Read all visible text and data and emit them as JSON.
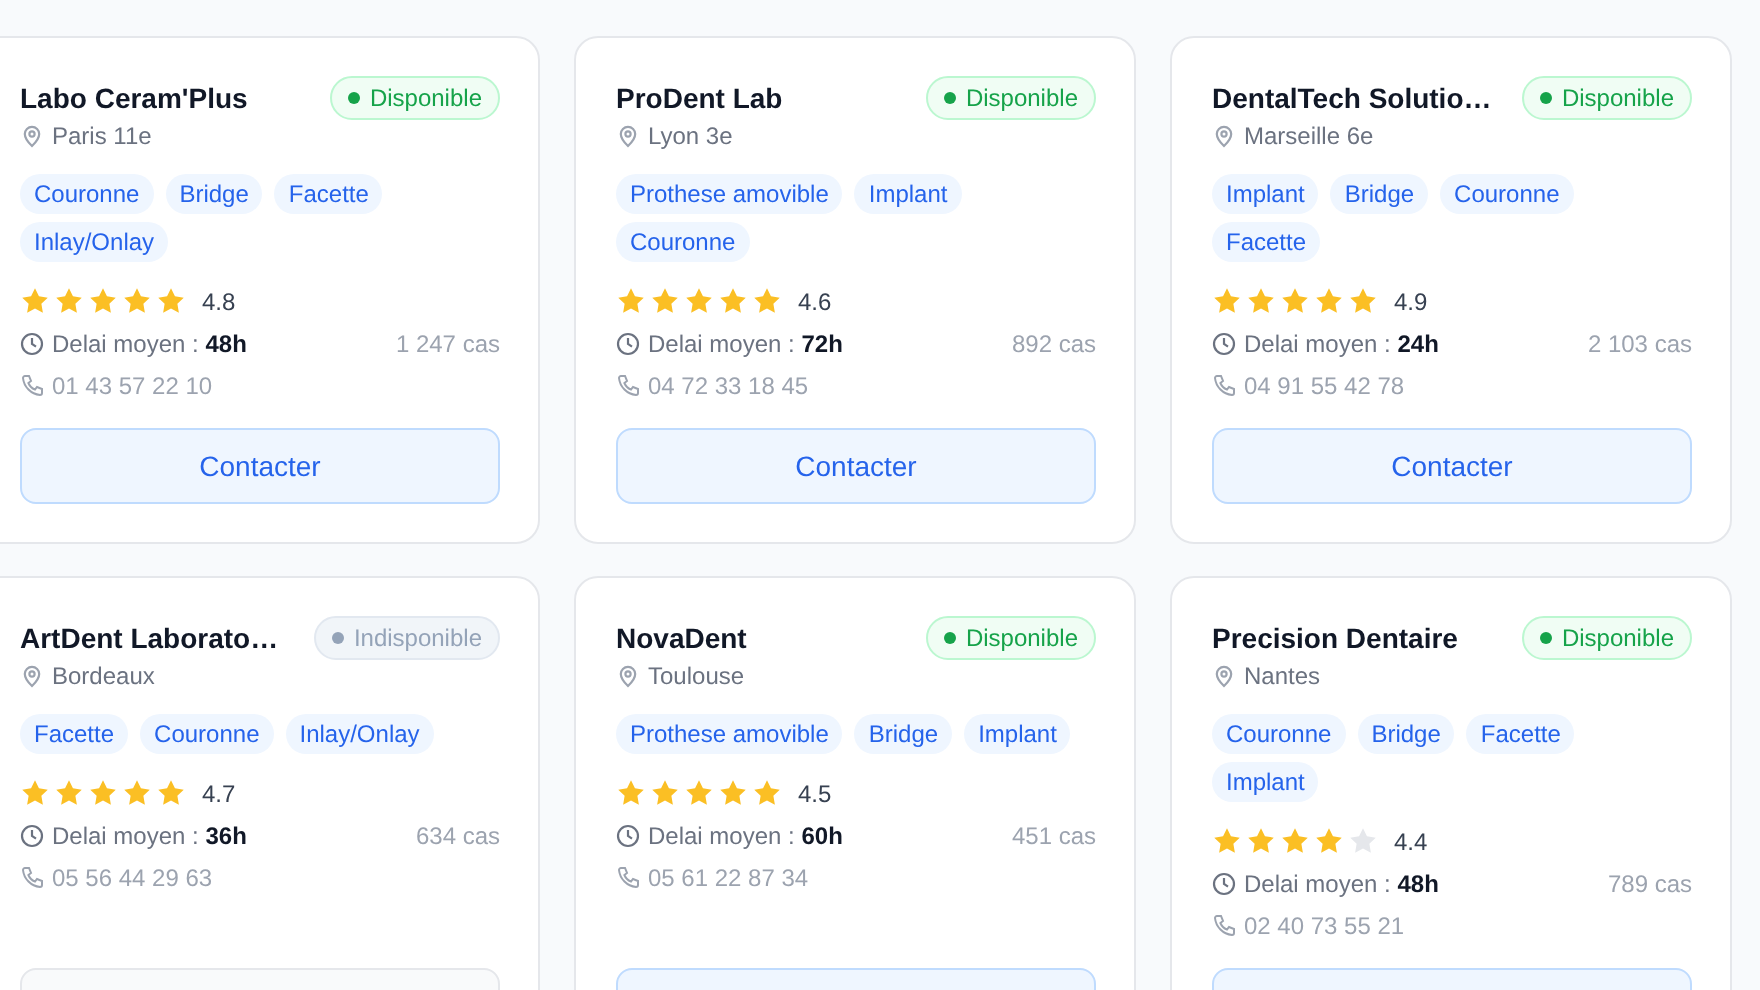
{
  "labs": [
    {
      "name": "Labo Ceram'Plus",
      "status": {
        "label": "Disponible",
        "available": true
      },
      "location": "Paris 11e",
      "tags": [
        "Couronne",
        "Bridge",
        "Facette",
        "Inlay/Onlay"
      ],
      "stars": 5,
      "rating": "4.8",
      "delay_label": "Delai moyen :",
      "delay": "48h",
      "cases": "1 247 cas",
      "phone": "01 43 57 22 10",
      "button": "Contacter"
    },
    {
      "name": "ProDent Lab",
      "status": {
        "label": "Disponible",
        "available": true
      },
      "location": "Lyon 3e",
      "tags": [
        "Prothese amovible",
        "Implant",
        "Couronne"
      ],
      "stars": 5,
      "rating": "4.6",
      "delay_label": "Delai moyen :",
      "delay": "72h",
      "cases": "892 cas",
      "phone": "04 72 33 18 45",
      "button": "Contacter"
    },
    {
      "name": "DentalTech Solutio…",
      "status": {
        "label": "Disponible",
        "available": true
      },
      "location": "Marseille 6e",
      "tags": [
        "Implant",
        "Bridge",
        "Couronne",
        "Facette"
      ],
      "stars": 5,
      "rating": "4.9",
      "delay_label": "Delai moyen :",
      "delay": "24h",
      "cases": "2 103 cas",
      "phone": "04 91 55 42 78",
      "button": "Contacter"
    },
    {
      "name": "ArtDent Laborato…",
      "status": {
        "label": "Indisponible",
        "available": false
      },
      "location": "Bordeaux",
      "tags": [
        "Facette",
        "Couronne",
        "Inlay/Onlay"
      ],
      "stars": 5,
      "rating": "4.7",
      "delay_label": "Delai moyen :",
      "delay": "36h",
      "cases": "634 cas",
      "phone": "05 56 44 29 63"
    },
    {
      "name": "NovaDent",
      "status": {
        "label": "Disponible",
        "available": true
      },
      "location": "Toulouse",
      "tags": [
        "Prothese amovible",
        "Bridge",
        "Implant"
      ],
      "stars": 5,
      "rating": "4.5",
      "delay_label": "Delai moyen :",
      "delay": "60h",
      "cases": "451 cas",
      "phone": "05 61 22 87 34"
    },
    {
      "name": "Precision Dentaire",
      "status": {
        "label": "Disponible",
        "available": true
      },
      "location": "Nantes",
      "tags": [
        "Couronne",
        "Bridge",
        "Facette",
        "Implant"
      ],
      "stars": 4,
      "rating": "4.4",
      "delay_label": "Delai moyen :",
      "delay": "48h",
      "cases": "789 cas",
      "phone": "02 40 73 55 21"
    }
  ]
}
